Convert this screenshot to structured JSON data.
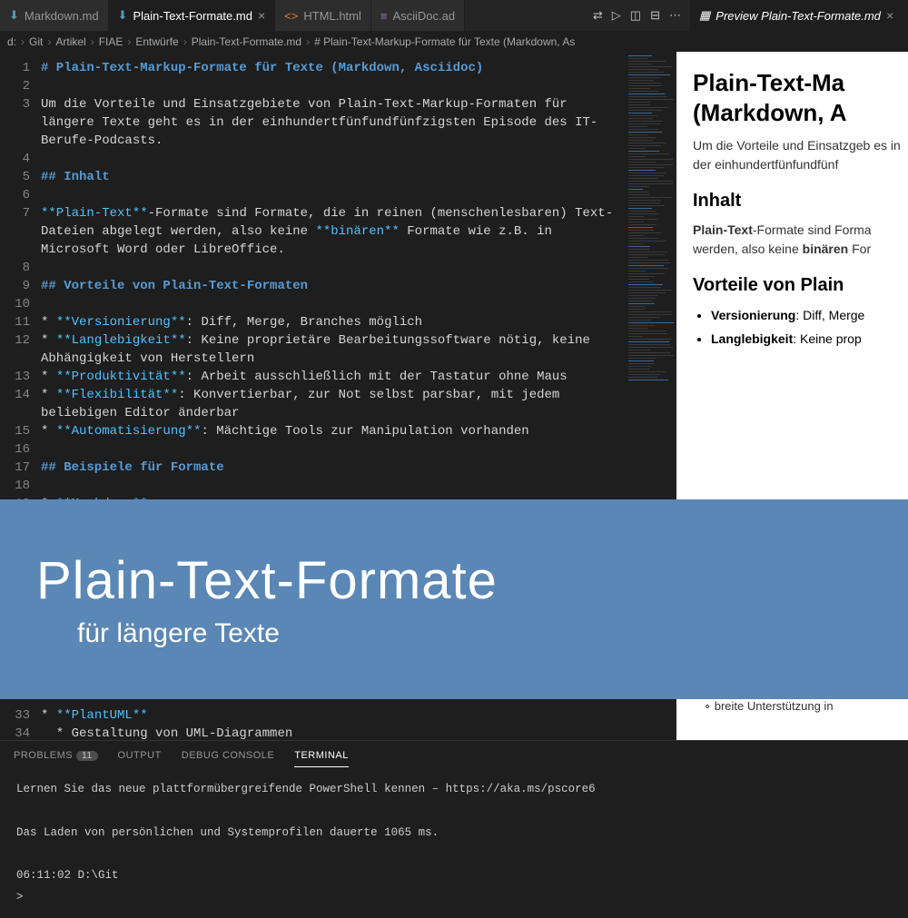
{
  "tabs": [
    {
      "icon": "arrow-down-blue",
      "label": "Markdown.md"
    },
    {
      "icon": "arrow-down-blue",
      "label": "Plain-Text-Formate.md",
      "active": true,
      "close": true
    },
    {
      "icon": "code-orange",
      "label": "HTML.html"
    },
    {
      "icon": "doc",
      "label": "AsciiDoc.ad"
    }
  ],
  "tabIcons": [
    "compare",
    "run",
    "split-h",
    "split-v",
    "more"
  ],
  "previewTab": {
    "label": "Preview Plain-Text-Formate.md",
    "close": true
  },
  "breadcrumb": [
    "d:",
    "Git",
    "Artikel",
    "FIAE",
    "Entwürfe",
    "Plain-Text-Formate.md",
    "# Plain-Text-Markup-Formate für Texte (Markdown, As"
  ],
  "lines": [
    {
      "n": 1,
      "t": "# Plain-Text-Markup-Formate für Texte (Markdown, Asciidoc)",
      "cls": "blue"
    },
    {
      "n": 2,
      "t": ""
    },
    {
      "n": 3,
      "t": "Um die Vorteile und Einsatzgebiete von Plain-Text-Markup-Formaten für längere Texte geht es in der einhundertfünfundfünfzigsten Episode des IT-Berufe-Podcasts."
    },
    {
      "n": 4,
      "t": ""
    },
    {
      "n": 5,
      "t": "## Inhalt",
      "cls": "blue"
    },
    {
      "n": 6,
      "t": ""
    },
    {
      "n": 7,
      "html": "<span class='cyan'>**Plain-Text**</span>-Formate sind Formate, die in reinen (menschenlesbaren) Text-Dateien abgelegt werden, also keine <span class='cyan'>**binären**</span> Formate wie z.B. in Microsoft Word oder LibreOffice."
    },
    {
      "n": 8,
      "t": ""
    },
    {
      "n": 9,
      "t": "## Vorteile von Plain-Text-Formaten",
      "cls": "blue"
    },
    {
      "n": 10,
      "t": ""
    },
    {
      "n": 11,
      "html": "* <span class='cyan'>**Versionierung**</span>: Diff, Merge, Branches möglich"
    },
    {
      "n": 12,
      "html": "* <span class='cyan'>**Langlebigkeit**</span>: Keine proprietäre Bearbeitungssoftware nötig, keine Abhängigkeit von Herstellern"
    },
    {
      "n": 13,
      "html": "* <span class='cyan'>**Produktivität**</span>: Arbeit ausschließlich mit der Tastatur ohne Maus"
    },
    {
      "n": 14,
      "html": "* <span class='cyan'>**Flexibilität**</span>: Konvertierbar, zur Not selbst parsbar, mit jedem beliebigen Editor änderbar"
    },
    {
      "n": 15,
      "html": "* <span class='cyan'>**Automatisierung**</span>: Mächtige Tools zur Manipulation vorhanden"
    },
    {
      "n": 16,
      "t": ""
    },
    {
      "n": 17,
      "t": "## Beispiele für Formate",
      "cls": "blue"
    },
    {
      "n": 18,
      "t": ""
    },
    {
      "n": 19,
      "html": "* <span class='cyan'>**Markdown**</span>"
    }
  ],
  "lines2": [
    {
      "n": 33,
      "html": "* <span class='cyan'>**PlantUML**</span>"
    },
    {
      "n": 34,
      "html": "&nbsp;&nbsp;* Gestaltung von UML-Diagrammen"
    }
  ],
  "preview": {
    "h1": "Plain-Text-Ma\n(Markdown, A",
    "p1": "Um die Vorteile und Einsatzgeb es in der einhundertfünfundfünf",
    "h2a": "Inhalt",
    "p2pre": "Plain-Text",
    "p2mid": "-Formate sind Forma werden, also keine ",
    "p2b": "binären",
    "p2post": " For",
    "h2b": "Vorteile von Plain",
    "li1b": "Versionierung",
    "li1": ": Diff, Merge",
    "li2b": "Langlebigkeit",
    "li2": ": Keine prop",
    "sub": "breite Unterstützung in"
  },
  "overlay": {
    "title": "Plain-Text-Formate",
    "sub": "für längere Texte"
  },
  "panel": {
    "tabs": [
      {
        "label": "PROBLEMS",
        "badge": "11"
      },
      {
        "label": "OUTPUT"
      },
      {
        "label": "DEBUG CONSOLE"
      },
      {
        "label": "TERMINAL",
        "active": true
      }
    ],
    "term": [
      "Lernen Sie das neue plattformübergreifende PowerShell kennen – https://aka.ms/pscore6",
      "",
      "Das Laden von persönlichen und Systemprofilen dauerte 1065 ms.",
      "",
      "06:11:02 D:\\Git",
      ">"
    ]
  }
}
